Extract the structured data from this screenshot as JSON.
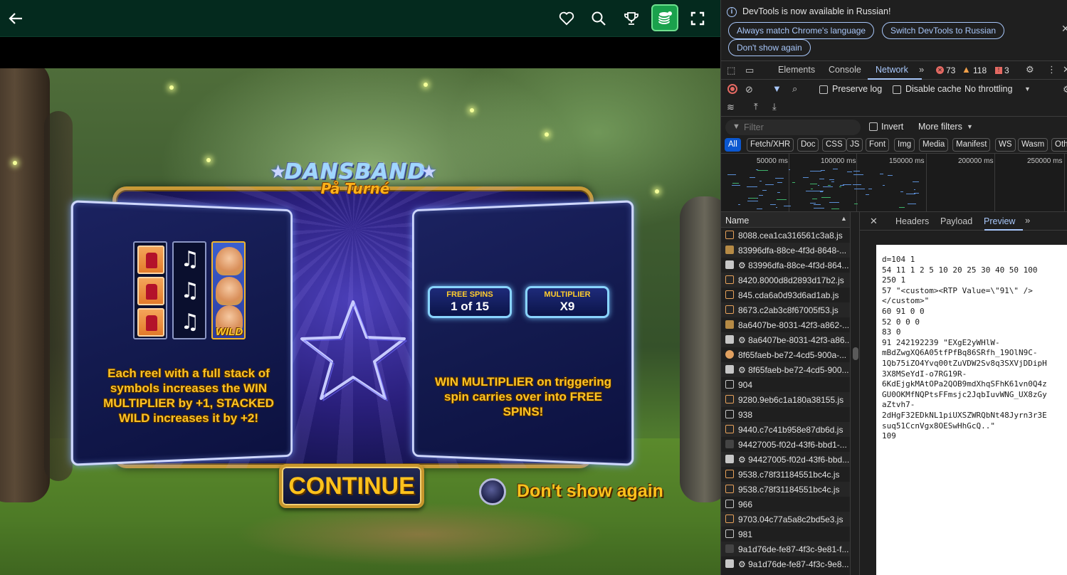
{
  "game": {
    "logo_title": "DANSBAND",
    "logo_subtitle": "På Turné",
    "left_panel_text": "Each reel with a full stack of symbols increases the WIN MULTIPLIER by +1, STACKED WILD increases it by +2!",
    "right_panel_text": "WIN MULTIPLIER on triggering spin carries over into FREE SPINS!",
    "wild_label": "WILD",
    "free_spins_label": "FREE SPINS",
    "free_spins_value": "1 of 15",
    "multiplier_label": "MULTIPLIER",
    "multiplier_value": "X9",
    "continue_label": "CONTINUE",
    "dont_show_label": "Don't show again",
    "note_symbol": "♫"
  },
  "icons": {
    "back": "back-arrow-icon",
    "favorite": "heart-icon",
    "search": "search-icon",
    "trophy": "trophy-icon",
    "coins": "coins-icon",
    "fullscreen": "fullscreen-icon"
  },
  "devtools": {
    "info_text": "DevTools is now available in Russian!",
    "btn_match": "Always match Chrome's language",
    "btn_switch": "Switch DevTools to Russian",
    "btn_dont_show": "Don't show again",
    "tabs": {
      "elements": "Elements",
      "console": "Console",
      "network": "Network"
    },
    "errors": "73",
    "warnings": "118",
    "issues": "3",
    "preserve_log": "Preserve log",
    "disable_cache": "Disable cache",
    "throttling": "No throttling",
    "filter_placeholder": "Filter",
    "invert": "Invert",
    "more_filters": "More filters",
    "types": [
      "All",
      "Fetch/XHR",
      "Doc",
      "CSS",
      "JS",
      "Font",
      "Img",
      "Media",
      "Manifest",
      "WS",
      "Wasm",
      "Oth"
    ],
    "timeline_labels": [
      "50000 ms",
      "100000 ms",
      "150000 ms",
      "200000 ms",
      "250000 ms"
    ],
    "name_header": "Name",
    "requests": [
      {
        "icon": "js",
        "name": "8088.cea1ca316561c3a8.js"
      },
      {
        "icon": "img",
        "name": "83996dfa-88ce-4f3d-8648-..."
      },
      {
        "icon": "gear",
        "name": "⚙ 83996dfa-88ce-4f3d-864..."
      },
      {
        "icon": "js",
        "name": "8420.8000d8d2893d17b2.js"
      },
      {
        "icon": "js",
        "name": "845.cda6a0d93d6ad1ab.js"
      },
      {
        "icon": "js",
        "name": "8673.c2ab3c8f67005f53.js"
      },
      {
        "icon": "img",
        "name": "8a6407be-8031-42f3-a862-..."
      },
      {
        "icon": "gear",
        "name": "⚙ 8a6407be-8031-42f3-a86..."
      },
      {
        "icon": "other",
        "name": "8f65faeb-be72-4cd5-900a-..."
      },
      {
        "icon": "gear",
        "name": "⚙ 8f65faeb-be72-4cd5-900..."
      },
      {
        "icon": "doc",
        "name": "904"
      },
      {
        "icon": "js",
        "name": "9280.9eb6c1a180a38155.js"
      },
      {
        "icon": "doc",
        "name": "938"
      },
      {
        "icon": "js",
        "name": "9440.c7c41b958e87db6d.js"
      },
      {
        "icon": "dark",
        "name": "94427005-f02d-43f6-bbd1-..."
      },
      {
        "icon": "gear",
        "name": "⚙ 94427005-f02d-43f6-bbd..."
      },
      {
        "icon": "js",
        "name": "9538.c78f31184551bc4c.js"
      },
      {
        "icon": "js",
        "name": "9538.c78f31184551bc4c.js"
      },
      {
        "icon": "doc",
        "name": "966"
      },
      {
        "icon": "js",
        "name": "9703.04c77a5a8c2bd5e3.js"
      },
      {
        "icon": "doc",
        "name": "981"
      },
      {
        "icon": "dark",
        "name": "9a1d76de-fe87-4f3c-9e81-f..."
      },
      {
        "icon": "gear",
        "name": "⚙ 9a1d76de-fe87-4f3c-9e8..."
      }
    ],
    "detail_tabs": {
      "headers": "Headers",
      "payload": "Payload",
      "preview": "Preview"
    },
    "preview_text": "d=104 1\n54 11 1 2 5 10 20 25 30 40 50 100\n250 1\n57 \"<custom><RTP Value=\\\"91\\\" />\n</custom>\"\n60 91 0 0\n52 0 0 0\n83 0\n91 242192239 \"EXgE2yWHlW-\nmBdZwgXQ6A05tfPfBq86SRfh_19OlN9C-\n1Qb75iZO4Yvq00tZuVDW2Sv8q3SXVjDDipH\n3X8MSeYdI-o7RG19R-\n6KdEjgkMAtOPa2QOB9mdXhqSFhK61vn0Q4z\nGU0OKMfNQPtsFFmsjc2JqbIuvWNG_UX8zGy\naZtvh7-\n2dHgF32EDkNL1piUXSZWRQbNt48Jyrn3r3E\nsuq51CcnVgx8OESwHhGcQ..\"\n109"
  }
}
